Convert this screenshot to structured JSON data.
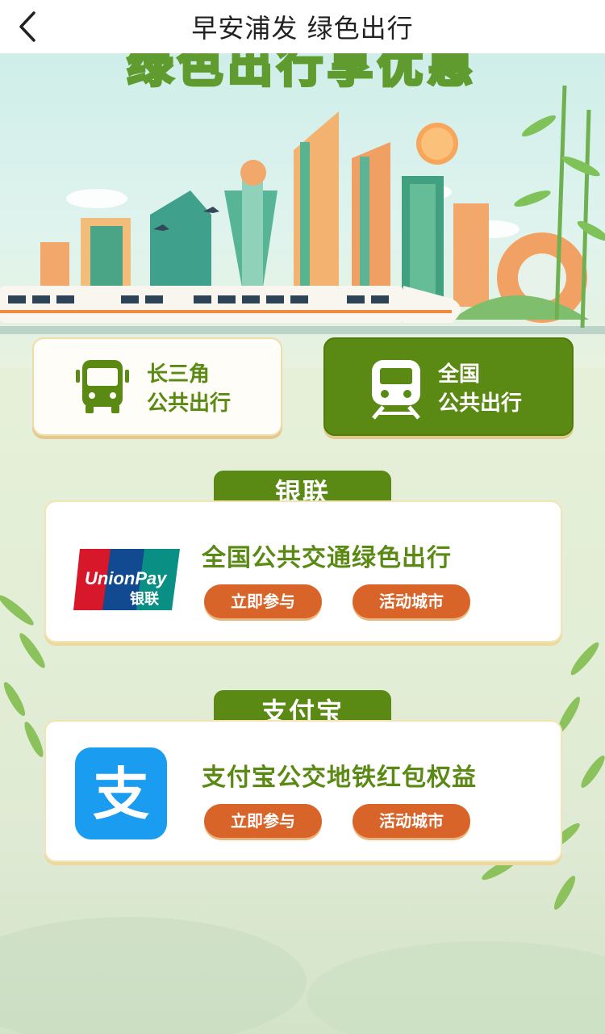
{
  "header": {
    "title": "早安浦发 绿色出行"
  },
  "banner": {
    "headline": "绿色出行享优惠"
  },
  "tiles": [
    {
      "line1": "长三角",
      "line2": "公共出行",
      "icon": "bus-icon"
    },
    {
      "line1": "全国",
      "line2": "公共出行",
      "icon": "train-icon"
    }
  ],
  "sections": [
    {
      "tab": "银联",
      "title": "全国公共交通绿色出行",
      "logo": "unionpay-logo",
      "logo_text": "UnionPay 银联",
      "join_label": "立即参与",
      "cities_label": "活动城市"
    },
    {
      "tab": "支付宝",
      "title": "支付宝公交地铁红包权益",
      "logo": "alipay-logo",
      "logo_text": "支",
      "join_label": "立即参与",
      "cities_label": "活动城市"
    }
  ],
  "colors": {
    "brand_green": "#5a8a13",
    "accent_orange": "#d9642a"
  }
}
